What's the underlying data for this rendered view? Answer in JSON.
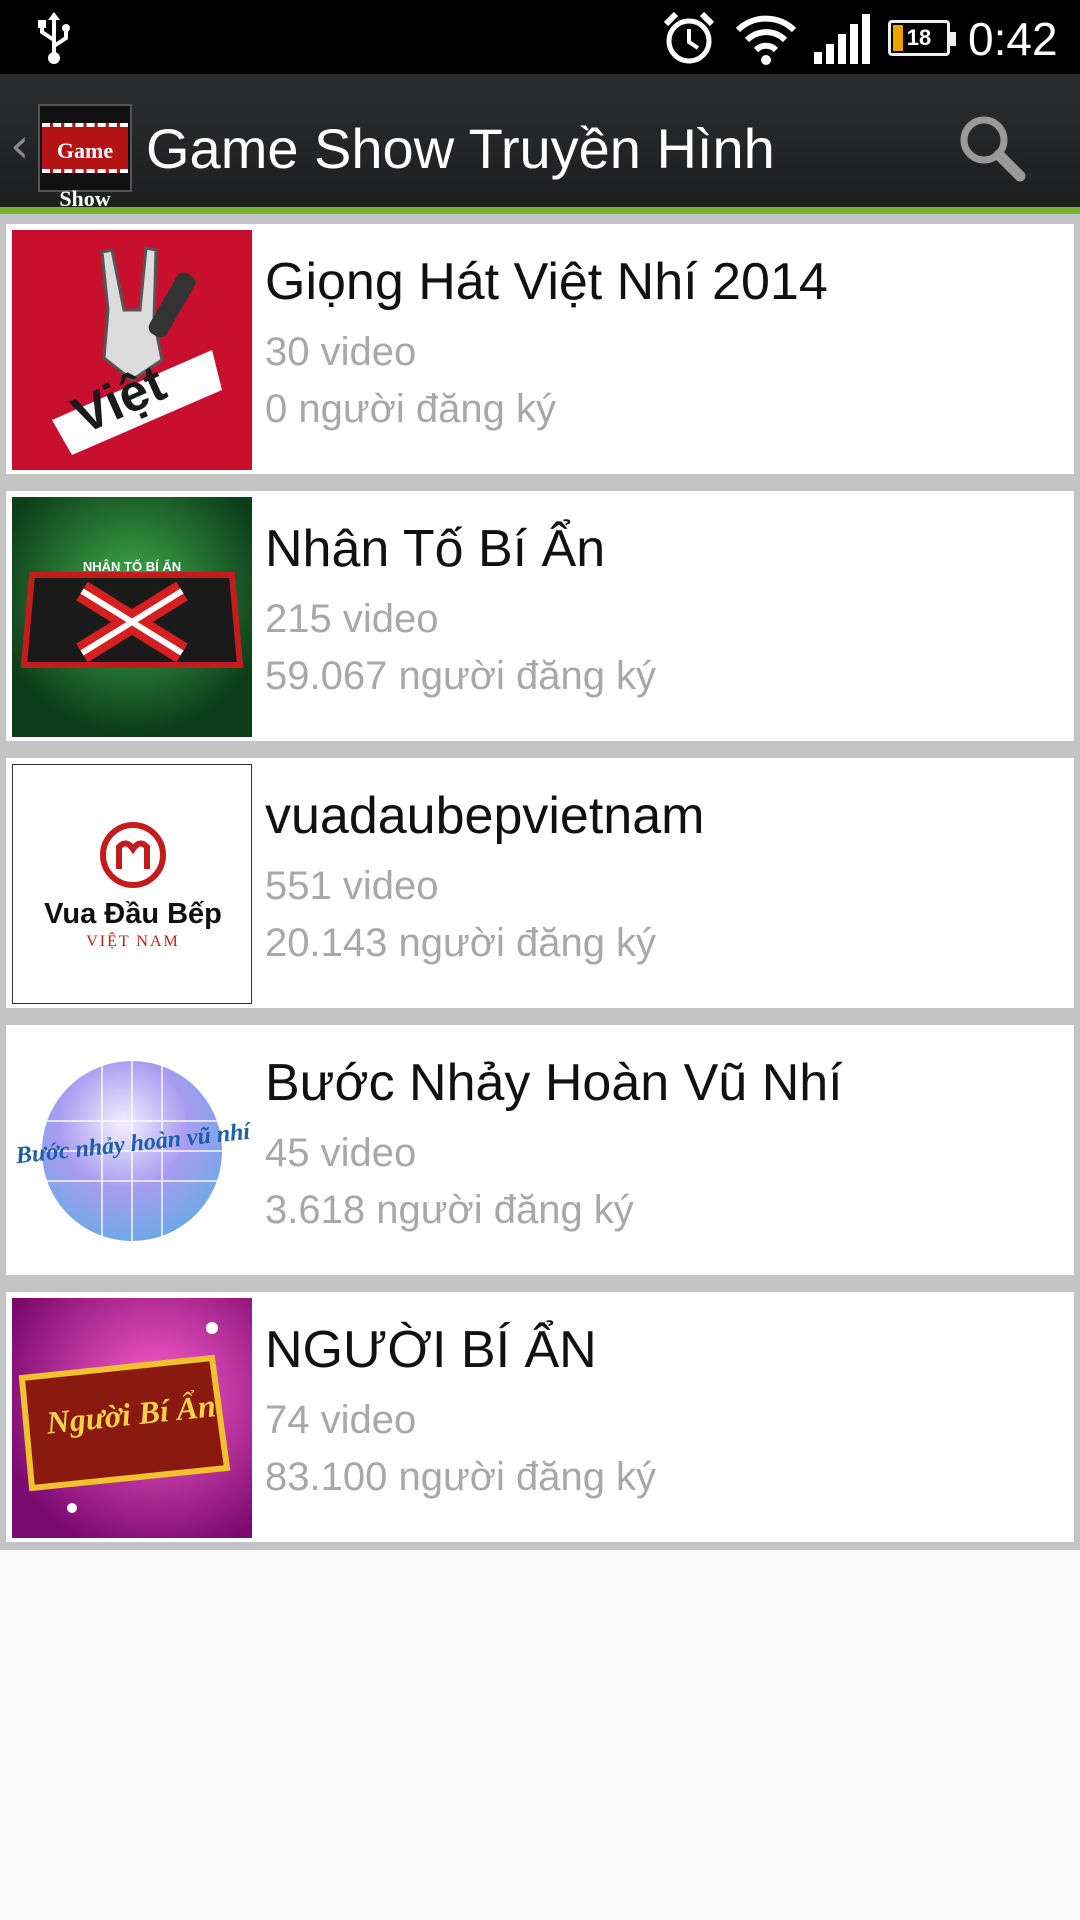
{
  "status_bar": {
    "time": "0:42",
    "battery_level": "18",
    "icons": [
      "usb-icon",
      "alarm-icon",
      "wifi-icon",
      "signal-icon",
      "battery-icon"
    ]
  },
  "action_bar": {
    "logo_text": "Game Show",
    "title": "Game Show Truyền Hình",
    "icons": [
      "back-chevron-icon",
      "search-icon"
    ]
  },
  "channels": [
    {
      "title": "Giọng Hát Việt Nhí 2014",
      "videos": "30 video",
      "subscribers": "0 người đăng ký",
      "thumb_text": "Việt"
    },
    {
      "title": "Nhân Tố Bí Ẩn",
      "videos": "215 video",
      "subscribers": "59.067 người đăng ký",
      "thumb_text": "NHÂN TỐ BÍ ẨN"
    },
    {
      "title": "vuadaubepvietnam",
      "videos": "551 video",
      "subscribers": "20.143 người đăng ký",
      "thumb_text": "Vua Đầu Bếp",
      "thumb_subtext": "VIỆT NAM"
    },
    {
      "title": "Bước Nhảy Hoàn Vũ Nhí",
      "videos": "45 video",
      "subscribers": "3.618 người đăng ký",
      "thumb_text": "Bước nhảy hoàn vũ nhí"
    },
    {
      "title": "NGƯỜI BÍ ẨN",
      "videos": "74 video",
      "subscribers": "83.100 người đăng ký",
      "thumb_text": "Người Bí Ẩn"
    }
  ],
  "colors": {
    "action_bar_accent": "#7ab22a",
    "meta_text": "#a8a8a8"
  }
}
